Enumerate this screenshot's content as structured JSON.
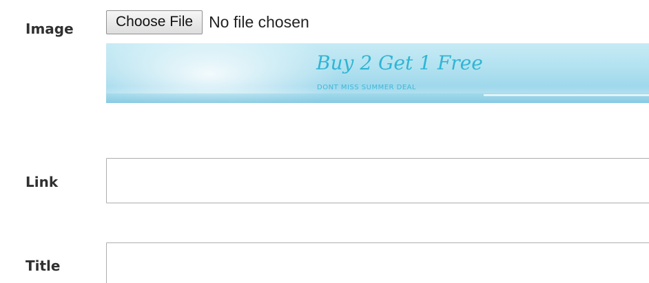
{
  "form": {
    "image_label": "Image",
    "link_label": "Link",
    "title_label": "Title",
    "file_button_label": "Choose File",
    "file_status": "No file chosen",
    "link_value": "",
    "title_value": ""
  },
  "banner": {
    "headline": "Buy 2 Get 1 Free",
    "subtext": "DONT MISS SUMMER DEAL"
  },
  "colors": {
    "banner_text": "#2fb5d4",
    "banner_sky": "#b0e0ef"
  }
}
